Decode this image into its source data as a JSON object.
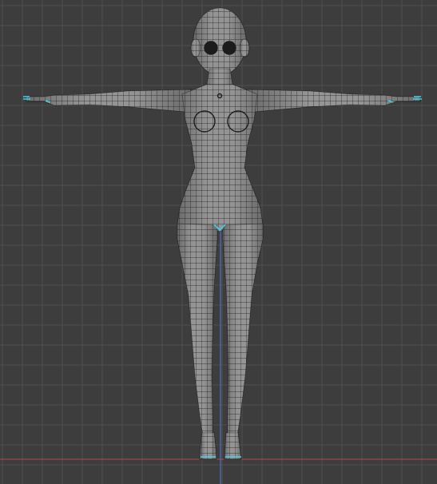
{
  "viewport": {
    "background": "#3d3d3d",
    "grid_minor_color": "#474747",
    "grid_major_color": "#505050",
    "x_axis_color": "#b8484e",
    "z_axis_color": "#4a72c8"
  },
  "mesh": {
    "fill": "#808080",
    "shade_dark": "#5a5a5a",
    "shade_light": "#a6a6a6",
    "wire_color": "#1c1c1c",
    "selected_color": "#3fd2e6"
  }
}
